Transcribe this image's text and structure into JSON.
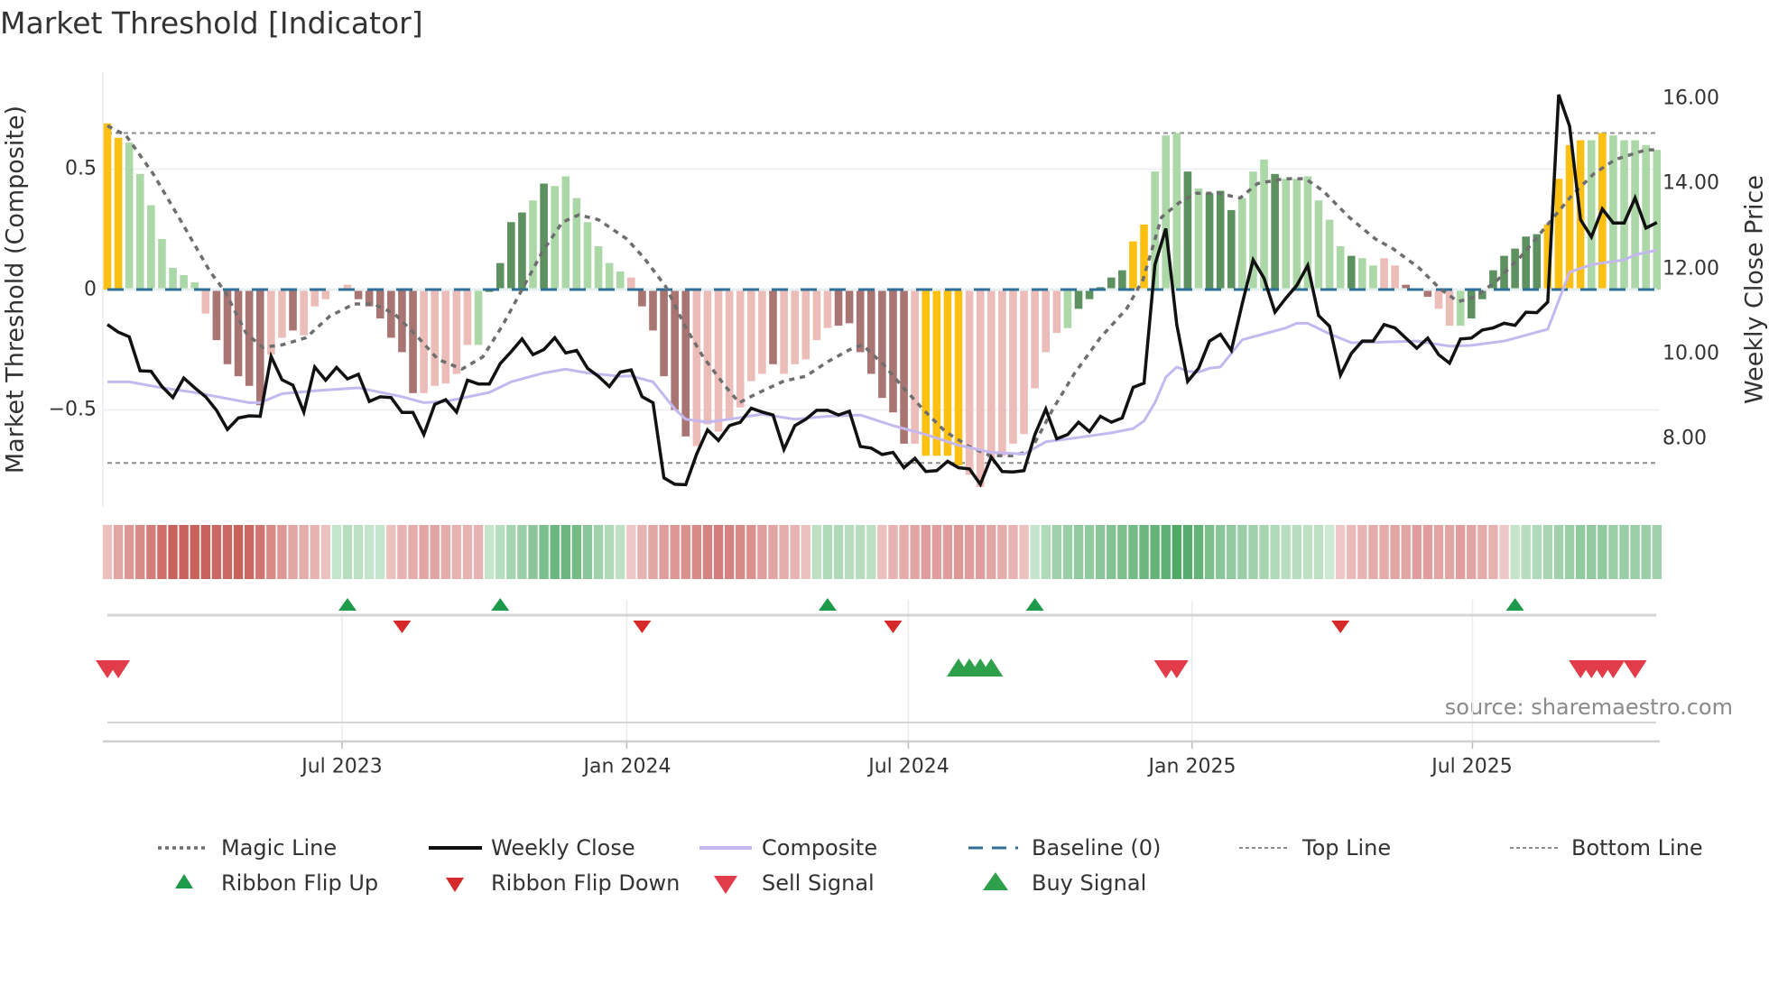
{
  "chart_data": {
    "type": "bar",
    "title": "Market Threshold [Indicator]",
    "ylabel_left": "Market Threshold (Composite)",
    "ylabel_right": "Weekly Close Price",
    "ylim_left": [
      -0.9,
      0.9
    ],
    "ylim_right": [
      6.5,
      16.6
    ],
    "left_ticks": [
      {
        "v": 0.5,
        "label": "0.5"
      },
      {
        "v": 0,
        "label": "0"
      },
      {
        "v": -0.5,
        "label": "−0.5"
      }
    ],
    "right_ticks": [
      {
        "v": 16,
        "label": "16.00"
      },
      {
        "v": 14,
        "label": "14.00"
      },
      {
        "v": 12,
        "label": "12.00"
      },
      {
        "v": 10,
        "label": "10.00"
      },
      {
        "v": 8,
        "label": "8.00"
      }
    ],
    "x_ticks": [
      {
        "week": 21.5,
        "label": "Jul 2023"
      },
      {
        "week": 47.6,
        "label": "Jan 2024"
      },
      {
        "week": 73.4,
        "label": "Jul 2024"
      },
      {
        "week": 99.4,
        "label": "Jan 2025"
      },
      {
        "week": 125.1,
        "label": "Jul 2025"
      }
    ],
    "weeks": 143,
    "top_line": 0.65,
    "bottom_line": -0.72,
    "baseline": 0,
    "bar_values": [
      0.69,
      0.63,
      0.61,
      0.48,
      0.35,
      0.21,
      0.09,
      0.06,
      0.03,
      -0.1,
      -0.21,
      -0.31,
      -0.36,
      -0.4,
      -0.48,
      -0.27,
      -0.2,
      -0.17,
      -0.19,
      -0.07,
      -0.04,
      -0.005,
      0.02,
      -0.04,
      -0.07,
      -0.12,
      -0.2,
      -0.26,
      -0.43,
      -0.43,
      -0.4,
      -0.39,
      -0.35,
      -0.23,
      -0.23,
      -0.01,
      0.11,
      0.28,
      0.32,
      0.37,
      0.44,
      0.43,
      0.47,
      0.38,
      0.28,
      0.18,
      0.11,
      0.075,
      0.05,
      -0.07,
      -0.17,
      -0.36,
      -0.5,
      -0.61,
      -0.65,
      -0.56,
      -0.59,
      -0.54,
      -0.49,
      -0.38,
      -0.35,
      -0.31,
      -0.35,
      -0.31,
      -0.29,
      -0.21,
      -0.16,
      -0.15,
      -0.14,
      -0.26,
      -0.35,
      -0.45,
      -0.51,
      -0.64,
      -0.64,
      -0.69,
      -0.69,
      -0.69,
      -0.73,
      -0.77,
      -0.82,
      -0.7,
      -0.69,
      -0.64,
      -0.6,
      -0.41,
      -0.26,
      -0.18,
      -0.16,
      -0.08,
      -0.04,
      0.01,
      0.05,
      0.08,
      0.2,
      0.27,
      0.49,
      0.64,
      0.65,
      0.49,
      0.42,
      0.4,
      0.41,
      0.33,
      0.38,
      0.49,
      0.54,
      0.48,
      0.46,
      0.46,
      0.47,
      0.37,
      0.29,
      0.18,
      0.14,
      0.13,
      0.1,
      0.13,
      0.1,
      0.02,
      -0.005,
      -0.03,
      -0.08,
      -0.15,
      -0.15,
      -0.12,
      -0.04,
      0.08,
      0.14,
      0.17,
      0.22,
      0.23,
      0.27,
      0.46,
      0.6,
      0.62,
      0.62,
      0.65,
      0.64,
      0.62,
      0.62,
      0.6,
      0.58
    ],
    "bar_classes": "YYgggggggpPPPPPppPpppgpPPPPPPpppppgGGGGgGgggggggpPPPPPpppppppPpppppPPPPPPPpYYYYpppppppppgGGGGGYYgggGgGGGgggGggggggGggppPPPppgGGGGGGGYYYYgYgg",
    "bar_class_colors": {
      "Y": "#fbc012",
      "g": "#acd8a8",
      "G": "#5e9160",
      "p": "#ecbdb8",
      "P": "#a97572"
    },
    "weekly_close": [
      10.68,
      10.5,
      10.39,
      9.59,
      9.58,
      9.22,
      8.96,
      9.42,
      9.19,
      8.98,
      8.66,
      8.21,
      8.48,
      8.53,
      8.52,
      9.93,
      9.38,
      9.25,
      8.62,
      9.68,
      9.37,
      9.67,
      9.4,
      9.51,
      8.87,
      8.98,
      8.96,
      8.61,
      8.61,
      8.09,
      8.8,
      8.91,
      8.62,
      9.37,
      9.28,
      9.28,
      9.76,
      10.04,
      10.34,
      9.97,
      10.09,
      10.37,
      10.01,
      10.07,
      9.65,
      9.46,
      9.22,
      9.56,
      9.61,
      8.98,
      8.84,
      7.07,
      6.92,
      6.91,
      7.63,
      8.2,
      7.95,
      8.3,
      8.38,
      8.71,
      8.62,
      8.55,
      7.74,
      8.3,
      8.45,
      8.66,
      8.66,
      8.55,
      8.64,
      7.81,
      7.77,
      7.62,
      7.67,
      7.31,
      7.53,
      7.22,
      7.24,
      7.46,
      7.31,
      7.28,
      6.92,
      7.56,
      7.22,
      7.21,
      7.24,
      8.09,
      8.69,
      7.99,
      8.09,
      8.38,
      8.16,
      8.52,
      8.38,
      8.48,
      9.2,
      9.3,
      12.09,
      12.94,
      10.68,
      9.34,
      9.65,
      10.29,
      10.45,
      10.07,
      11.17,
      12.2,
      11.77,
      10.97,
      11.3,
      11.6,
      12.07,
      10.89,
      10.64,
      9.49,
      10.0,
      10.29,
      10.29,
      10.68,
      10.6,
      10.36,
      10.12,
      10.36,
      9.97,
      9.77,
      10.34,
      10.36,
      10.55,
      10.6,
      10.71,
      10.66,
      10.97,
      10.96,
      11.21,
      16.09,
      15.35,
      13.15,
      12.74,
      13.4,
      13.07,
      13.07,
      13.66,
      12.95,
      13.08
    ],
    "composite": [
      [
        0,
        9.33
      ],
      [
        2,
        9.33
      ],
      [
        5,
        9.19
      ],
      [
        8,
        9.08
      ],
      [
        13,
        8.84
      ],
      [
        14,
        8.84
      ],
      [
        16,
        9.05
      ],
      [
        19,
        9.12
      ],
      [
        23,
        9.19
      ],
      [
        27,
        8.98
      ],
      [
        29,
        8.84
      ],
      [
        31,
        8.87
      ],
      [
        35,
        9.08
      ],
      [
        37,
        9.33
      ],
      [
        40,
        9.54
      ],
      [
        42,
        9.63
      ],
      [
        44,
        9.54
      ],
      [
        47,
        9.46
      ],
      [
        48,
        9.47
      ],
      [
        50,
        9.33
      ],
      [
        52,
        8.69
      ],
      [
        53,
        8.45
      ],
      [
        55,
        8.38
      ],
      [
        57,
        8.45
      ],
      [
        60,
        8.57
      ],
      [
        63,
        8.45
      ],
      [
        66,
        8.52
      ],
      [
        69,
        8.55
      ],
      [
        72,
        8.3
      ],
      [
        75,
        8.09
      ],
      [
        78,
        7.84
      ],
      [
        81,
        7.67
      ],
      [
        84,
        7.63
      ],
      [
        86,
        7.92
      ],
      [
        89,
        8.02
      ],
      [
        92,
        8.13
      ],
      [
        94,
        8.23
      ],
      [
        95,
        8.41
      ],
      [
        96,
        8.84
      ],
      [
        97,
        9.44
      ],
      [
        98,
        9.68
      ],
      [
        99,
        9.58
      ],
      [
        100,
        9.56
      ],
      [
        101,
        9.65
      ],
      [
        102,
        9.68
      ],
      [
        104,
        10.32
      ],
      [
        106,
        10.46
      ],
      [
        108,
        10.6
      ],
      [
        109,
        10.71
      ],
      [
        110,
        10.71
      ],
      [
        112,
        10.46
      ],
      [
        114,
        10.25
      ],
      [
        116,
        10.26
      ],
      [
        120,
        10.29
      ],
      [
        123,
        10.17
      ],
      [
        125,
        10.19
      ],
      [
        128,
        10.29
      ],
      [
        132,
        10.57
      ],
      [
        133,
        11.24
      ],
      [
        134,
        11.91
      ],
      [
        136,
        12.09
      ],
      [
        139,
        12.2
      ],
      [
        140,
        12.32
      ],
      [
        142,
        12.43
      ]
    ],
    "magic_line": [
      [
        0,
        0.68
      ],
      [
        1.7,
        0.64
      ],
      [
        4.2,
        0.48
      ],
      [
        6.8,
        0.28
      ],
      [
        9.4,
        0.075
      ],
      [
        10.8,
        -0.01
      ],
      [
        12.7,
        -0.18
      ],
      [
        14.2,
        -0.24
      ],
      [
        16,
        -0.23
      ],
      [
        18.2,
        -0.2
      ],
      [
        20.4,
        -0.11
      ],
      [
        22.6,
        -0.06
      ],
      [
        24.4,
        -0.06
      ],
      [
        26.3,
        -0.1
      ],
      [
        28.5,
        -0.2
      ],
      [
        30.3,
        -0.29
      ],
      [
        32.5,
        -0.33
      ],
      [
        34.4,
        -0.28
      ],
      [
        36.2,
        -0.15
      ],
      [
        38,
        0
      ],
      [
        39.9,
        0.16
      ],
      [
        41.7,
        0.28
      ],
      [
        43.2,
        0.31
      ],
      [
        45,
        0.29
      ],
      [
        47.6,
        0.21
      ],
      [
        49.2,
        0.13
      ],
      [
        51.2,
        0.01
      ],
      [
        52.9,
        -0.15
      ],
      [
        54.6,
        -0.28
      ],
      [
        56.6,
        -0.4
      ],
      [
        57.9,
        -0.47
      ],
      [
        59.6,
        -0.43
      ],
      [
        62,
        -0.38
      ],
      [
        64,
        -0.36
      ],
      [
        66,
        -0.3
      ],
      [
        68,
        -0.25
      ],
      [
        69.2,
        -0.23
      ],
      [
        71.1,
        -0.31
      ],
      [
        72.8,
        -0.4
      ],
      [
        74.8,
        -0.5
      ],
      [
        76.8,
        -0.59
      ],
      [
        78.9,
        -0.65
      ],
      [
        80.9,
        -0.69
      ],
      [
        82.9,
        -0.69
      ],
      [
        84.6,
        -0.67
      ],
      [
        86.6,
        -0.5
      ],
      [
        88.6,
        -0.35
      ],
      [
        91,
        -0.2
      ],
      [
        93.4,
        -0.08
      ],
      [
        94.9,
        0.04
      ],
      [
        96.6,
        0.3
      ],
      [
        98.2,
        0.36
      ],
      [
        99.8,
        0.4
      ],
      [
        101.8,
        0.4
      ],
      [
        103.8,
        0.38
      ],
      [
        105.4,
        0.44
      ],
      [
        107.8,
        0.46
      ],
      [
        109.8,
        0.46
      ],
      [
        111.4,
        0.41
      ],
      [
        113.8,
        0.3
      ],
      [
        116.2,
        0.21
      ],
      [
        117.8,
        0.17
      ],
      [
        120.2,
        0.09
      ],
      [
        122.2,
        0
      ],
      [
        123.8,
        -0.05
      ],
      [
        125.4,
        -0.03
      ],
      [
        127.4,
        0.04
      ],
      [
        129.8,
        0.15
      ],
      [
        131.8,
        0.26
      ],
      [
        134.2,
        0.39
      ],
      [
        136.2,
        0.48
      ],
      [
        138.2,
        0.54
      ],
      [
        141,
        0.58
      ],
      [
        142,
        0.58
      ]
    ],
    "ribbon": [
      -0.2,
      -0.4,
      -0.5,
      -0.6,
      -0.7,
      -0.8,
      -0.9,
      -0.9,
      -0.9,
      -0.9,
      -0.85,
      -0.85,
      -0.9,
      -0.85,
      -0.75,
      -0.6,
      -0.5,
      -0.4,
      -0.35,
      -0.3,
      -0.2,
      0.2,
      0.3,
      0.25,
      0.2,
      0.2,
      -0.2,
      -0.3,
      -0.35,
      -0.4,
      -0.4,
      -0.35,
      -0.3,
      -0.3,
      -0.3,
      0.2,
      0.3,
      0.4,
      0.5,
      0.6,
      0.7,
      0.8,
      0.8,
      0.75,
      0.6,
      0.45,
      0.35,
      0.25,
      -0.15,
      -0.3,
      -0.4,
      -0.45,
      -0.5,
      -0.55,
      -0.6,
      -0.65,
      -0.7,
      -0.65,
      -0.6,
      -0.55,
      -0.45,
      -0.4,
      -0.35,
      -0.3,
      -0.2,
      0.25,
      0.35,
      0.35,
      0.3,
      0.3,
      0.25,
      -0.2,
      -0.3,
      -0.35,
      -0.4,
      -0.45,
      -0.45,
      -0.45,
      -0.5,
      -0.45,
      -0.45,
      -0.4,
      -0.35,
      -0.3,
      -0.2,
      0.2,
      0.35,
      0.45,
      0.5,
      0.55,
      0.55,
      0.6,
      0.65,
      0.7,
      0.75,
      0.8,
      0.85,
      0.9,
      1.0,
      0.95,
      0.85,
      0.7,
      0.6,
      0.55,
      0.5,
      0.45,
      0.4,
      0.35,
      0.3,
      0.3,
      0.25,
      0.25,
      0.15,
      -0.15,
      -0.25,
      -0.3,
      -0.35,
      -0.35,
      -0.4,
      -0.4,
      -0.45,
      -0.45,
      -0.4,
      -0.4,
      -0.45,
      -0.4,
      -0.35,
      -0.3,
      -0.15,
      0.2,
      0.3,
      0.35,
      0.4,
      0.45,
      0.5,
      0.55,
      0.55,
      0.55,
      0.5,
      0.5,
      0.5,
      0.5,
      0.45
    ],
    "ribbon_flip_up": [
      22,
      36,
      66,
      85,
      129
    ],
    "ribbon_flip_down": [
      27,
      49,
      72,
      113
    ],
    "sell_signals": [
      0,
      1,
      97,
      98,
      135,
      136,
      137,
      138,
      140
    ],
    "buy_signals": [
      78,
      79,
      80,
      81
    ],
    "colors": {
      "weekly_close": "#111111",
      "composite": "#c4b8ef",
      "magic_line": "#6e6e6e",
      "baseline": "#2f6f97",
      "top_bottom": "#8c8c8c",
      "flip_up": "#1e9a4b",
      "flip_down": "#d62a2a",
      "sell": "#e23b4a",
      "buy": "#2ea04c"
    },
    "legend": {
      "magic_line": "Magic Line",
      "weekly_close": "Weekly Close",
      "composite": "Composite",
      "baseline": "Baseline (0)",
      "top_line": "Top Line",
      "bottom_line": "Bottom Line",
      "ribbon_flip_up": "Ribbon Flip Up",
      "ribbon_flip_down": "Ribbon Flip Down",
      "sell_signal": "Sell Signal",
      "buy_signal": "Buy Signal"
    },
    "legend_placement": "bottom",
    "source": "source: sharemaestro.com"
  }
}
